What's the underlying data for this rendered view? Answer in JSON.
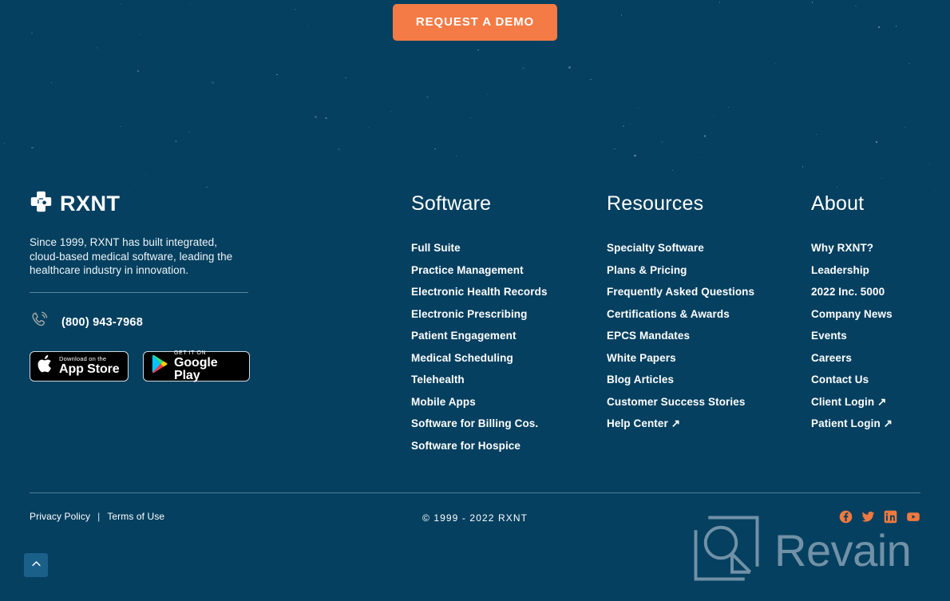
{
  "cta": {
    "label": "REQUEST A DEMO",
    "color": "#f47b45"
  },
  "theme": {
    "background": "#054060",
    "accent": "#f47b45",
    "social_icon_color": "#f0793f",
    "scrolltop_bg": "#1a6089",
    "text": "#ffffff"
  },
  "brand": {
    "logo_icon": "rxnt-cross-icon",
    "name": "RXNT",
    "description": "Since 1999, RXNT has built integrated, cloud-based medical software, leading the healthcare industry in innovation.",
    "phone_icon": "phone-ring-icon",
    "phone": "(800) 943-7968",
    "badges": [
      {
        "icon": "apple-icon",
        "top_line": "Download on the",
        "main_line": "App Store",
        "name": "app-store-badge"
      },
      {
        "icon": "google-play-icon",
        "top_line": "GET IT ON",
        "main_line": "Google Play",
        "name": "google-play-badge"
      }
    ]
  },
  "columns": [
    {
      "title": "Software",
      "key": "software",
      "links": [
        {
          "label": "Full Suite",
          "external": false
        },
        {
          "label": "Practice Management",
          "external": false
        },
        {
          "label": "Electronic Health Records",
          "external": false
        },
        {
          "label": "Electronic Prescribing",
          "external": false
        },
        {
          "label": "Patient Engagement",
          "external": false
        },
        {
          "label": "Medical Scheduling",
          "external": false
        },
        {
          "label": "Telehealth",
          "external": false
        },
        {
          "label": "Mobile Apps",
          "external": false
        },
        {
          "label": "Software for Billing Cos.",
          "external": false
        },
        {
          "label": "Software for Hospice",
          "external": false
        }
      ]
    },
    {
      "title": "Resources",
      "key": "resources",
      "links": [
        {
          "label": "Specialty Software",
          "external": false
        },
        {
          "label": "Plans & Pricing",
          "external": false
        },
        {
          "label": "Frequently Asked Questions",
          "external": false
        },
        {
          "label": "Certifications & Awards",
          "external": false
        },
        {
          "label": "EPCS Mandates",
          "external": false
        },
        {
          "label": "White Papers",
          "external": false
        },
        {
          "label": "Blog Articles",
          "external": false
        },
        {
          "label": "Customer Success Stories",
          "external": false
        },
        {
          "label": "Help Center ↗",
          "external": true
        }
      ]
    },
    {
      "title": "About",
      "key": "about",
      "links": [
        {
          "label": "Why RXNT?",
          "external": false
        },
        {
          "label": "Leadership",
          "external": false
        },
        {
          "label": "2022 Inc. 5000",
          "external": false
        },
        {
          "label": "Company News",
          "external": false
        },
        {
          "label": "Events",
          "external": false
        },
        {
          "label": "Careers",
          "external": false
        },
        {
          "label": "Contact Us",
          "external": false
        },
        {
          "label": "Client Login ↗",
          "external": true
        },
        {
          "label": "Patient Login ↗",
          "external": true
        }
      ]
    }
  ],
  "bottom": {
    "privacy_policy": "Privacy Policy",
    "separator": "|",
    "terms_of_use": "Terms of Use",
    "copyright": "©  1999  -  2022  RXNT",
    "socials": [
      {
        "name": "facebook-icon",
        "label": "Facebook"
      },
      {
        "name": "twitter-icon",
        "label": "Twitter"
      },
      {
        "name": "linkedin-icon",
        "label": "LinkedIn"
      },
      {
        "name": "youtube-icon",
        "label": "YouTube"
      }
    ],
    "scroll_top_icon": "chevron-up-icon"
  },
  "watermark": {
    "icon": "revain-logo-icon",
    "text": "Revain"
  }
}
